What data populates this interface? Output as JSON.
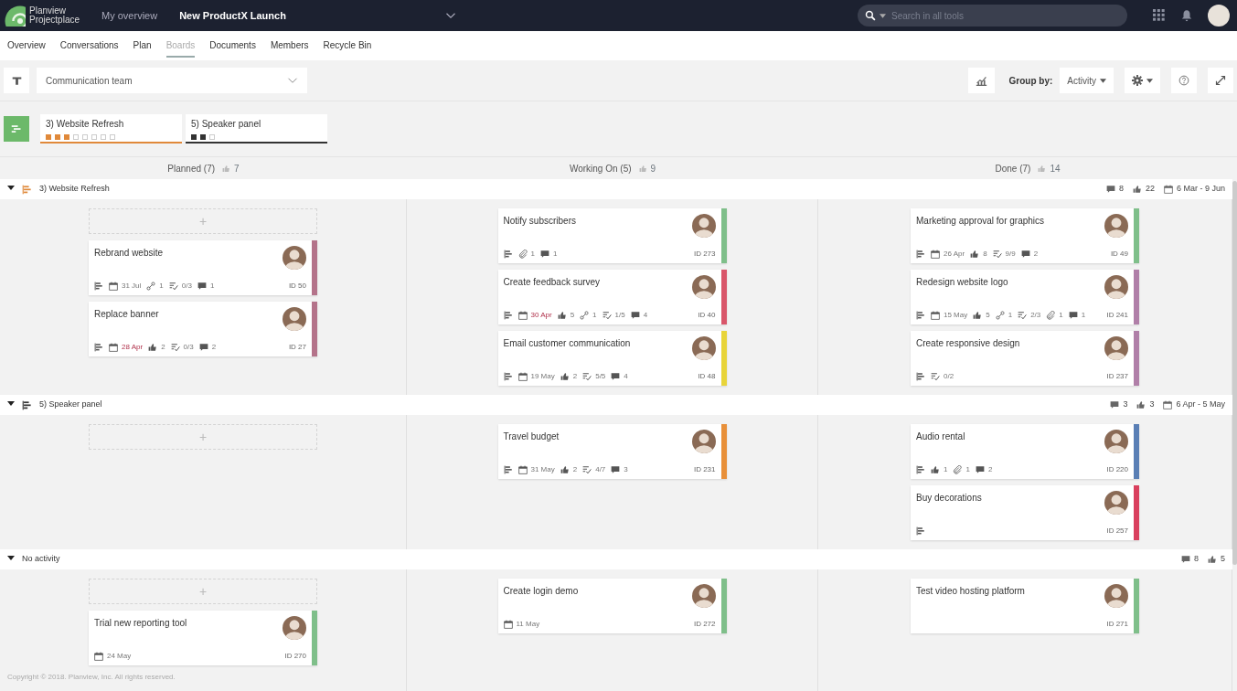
{
  "topbar": {
    "brand": [
      "Planview",
      "Projectplace"
    ],
    "links": [
      {
        "label": "My overview",
        "selected": false
      },
      {
        "label": "New ProductX Launch",
        "selected": true
      }
    ],
    "search": {
      "placeholder": "Search in all tools"
    }
  },
  "tabs": [
    {
      "label": "Overview",
      "selected": false
    },
    {
      "label": "Conversations",
      "selected": false
    },
    {
      "label": "Plan",
      "selected": false
    },
    {
      "label": "Boards",
      "selected": true
    },
    {
      "label": "Documents",
      "selected": false
    },
    {
      "label": "Members",
      "selected": false
    },
    {
      "label": "Recycle Bin",
      "selected": false
    }
  ],
  "toolbar": {
    "filter": {
      "value": "Communication team"
    },
    "group_by_label": "Group by:",
    "group_by": "Activity"
  },
  "plans": [
    {
      "label": "3) Website Refresh",
      "color": "#e0893a",
      "progress": [
        true,
        true,
        true,
        false,
        false,
        false,
        false,
        false
      ]
    },
    {
      "label": "5) Speaker panel",
      "color": "#333333",
      "progress": [
        true,
        true,
        false
      ]
    }
  ],
  "columns": [
    {
      "title": "Planned (7)",
      "likes": "7"
    },
    {
      "title": "Working On (5)",
      "likes": "9"
    },
    {
      "title": "Done (7)",
      "likes": "14"
    }
  ],
  "lanes": [
    {
      "name": "3) Website Refresh",
      "expanded": true,
      "color": "#e0893a",
      "summary": [
        {
          "kind": "comments",
          "text": "8"
        },
        {
          "kind": "likes",
          "text": "22"
        },
        {
          "kind": "date",
          "text": "6 Mar - 9 Jun"
        }
      ],
      "columns": [
        {
          "add_slot": "+",
          "cards": [
            {
              "title": "Rebrand website",
              "id": "ID 50",
              "color": "#b4738a",
              "meta": [
                {
                  "kind": "plan"
                },
                {
                  "kind": "date",
                  "text": "31 Jul"
                },
                {
                  "kind": "link",
                  "text": "1"
                },
                {
                  "kind": "checklist",
                  "text": "0/3"
                },
                {
                  "kind": "comments",
                  "text": "1"
                }
              ]
            },
            {
              "title": "Replace banner",
              "id": "ID 27",
              "color": "#b4738a",
              "meta": [
                {
                  "kind": "plan"
                },
                {
                  "kind": "overdue_date",
                  "text": "28 Apr"
                },
                {
                  "kind": "likes",
                  "text": "2"
                },
                {
                  "kind": "checklist",
                  "text": "0/3"
                },
                {
                  "kind": "comments",
                  "text": "2"
                }
              ]
            }
          ]
        },
        {
          "cards": [
            {
              "title": "Notify subscribers",
              "id": "ID 273",
              "color": "#7fbf8a",
              "meta": [
                {
                  "kind": "plan"
                },
                {
                  "kind": "attach",
                  "text": "1"
                },
                {
                  "kind": "comments",
                  "text": "1"
                }
              ]
            },
            {
              "title": "Create feedback survey",
              "id": "ID 40",
              "color": "#d9566a",
              "meta": [
                {
                  "kind": "plan"
                },
                {
                  "kind": "overdue_date",
                  "text": "30 Apr"
                },
                {
                  "kind": "likes",
                  "text": "5"
                },
                {
                  "kind": "link",
                  "text": "1"
                },
                {
                  "kind": "checklist",
                  "text": "1/5"
                },
                {
                  "kind": "comments",
                  "text": "4"
                }
              ]
            },
            {
              "title": "Email customer communication",
              "id": "ID 48",
              "color": "#e8d43a",
              "meta": [
                {
                  "kind": "plan"
                },
                {
                  "kind": "date",
                  "text": "19 May"
                },
                {
                  "kind": "likes",
                  "text": "2"
                },
                {
                  "kind": "checklist",
                  "text": "5/5"
                },
                {
                  "kind": "comments",
                  "text": "4"
                }
              ]
            }
          ]
        },
        {
          "cards": [
            {
              "title": "Marketing approval for graphics",
              "id": "ID 49",
              "color": "#7fbf8a",
              "meta": [
                {
                  "kind": "plan"
                },
                {
                  "kind": "date",
                  "text": "26 Apr"
                },
                {
                  "kind": "likes",
                  "text": "8"
                },
                {
                  "kind": "checklist",
                  "text": "9/9"
                },
                {
                  "kind": "comments",
                  "text": "2"
                }
              ]
            },
            {
              "title": "Redesign website logo",
              "id": "ID 241",
              "color": "#b07fa8",
              "meta": [
                {
                  "kind": "plan"
                },
                {
                  "kind": "date",
                  "text": "15 May"
                },
                {
                  "kind": "likes",
                  "text": "5"
                },
                {
                  "kind": "link",
                  "text": "1"
                },
                {
                  "kind": "checklist",
                  "text": "2/3"
                },
                {
                  "kind": "attach",
                  "text": "1"
                },
                {
                  "kind": "comments",
                  "text": "1"
                }
              ]
            },
            {
              "title": "Create responsive design",
              "id": "ID 237",
              "color": "#b07fa8",
              "meta": [
                {
                  "kind": "plan"
                },
                {
                  "kind": "checklist",
                  "text": "0/2"
                }
              ]
            }
          ]
        }
      ]
    },
    {
      "name": "5) Speaker panel",
      "expanded": true,
      "color": "#333333",
      "summary": [
        {
          "kind": "comments",
          "text": "3"
        },
        {
          "kind": "likes",
          "text": "3"
        },
        {
          "kind": "date",
          "text": "6 Apr - 5 May"
        }
      ],
      "columns": [
        {
          "add_slot": "+"
        },
        {
          "cards": [
            {
              "title": "Travel budget",
              "id": "ID 231",
              "color": "#e8903a",
              "meta": [
                {
                  "kind": "plan"
                },
                {
                  "kind": "date",
                  "text": "31 May"
                },
                {
                  "kind": "likes",
                  "text": "2"
                },
                {
                  "kind": "checklist",
                  "text": "4/7"
                },
                {
                  "kind": "comments",
                  "text": "3"
                }
              ]
            }
          ]
        },
        {
          "cards": [
            {
              "title": "Audio rental",
              "id": "ID 220",
              "color": "#5a7fb5",
              "meta": [
                {
                  "kind": "plan"
                },
                {
                  "kind": "likes",
                  "text": "1"
                },
                {
                  "kind": "attach",
                  "text": "1"
                },
                {
                  "kind": "comments",
                  "text": "2"
                }
              ]
            },
            {
              "title": "Buy decorations",
              "id": "ID 257",
              "color": "#d9405e",
              "meta": [
                {
                  "kind": "plan"
                }
              ]
            }
          ]
        }
      ]
    },
    {
      "name": "No activity",
      "expanded": true,
      "summary": [
        {
          "kind": "comments",
          "text": "8"
        },
        {
          "kind": "likes",
          "text": "5"
        }
      ],
      "columns": [
        {
          "add_slot": "+",
          "cards": [
            {
              "title": "Trial new reporting tool",
              "id": "ID 270",
              "color": "#7fbf8a",
              "meta": [
                {
                  "kind": "date",
                  "text": "24 May"
                }
              ]
            }
          ]
        },
        {
          "cards": [
            {
              "title": "Create login demo",
              "id": "ID 272",
              "color": "#7fbf8a",
              "meta": [
                {
                  "kind": "date",
                  "text": "11 May"
                }
              ]
            }
          ]
        },
        {
          "cards": [
            {
              "title": "Test video hosting platform",
              "id": "ID 271",
              "color": "#7fbf8a"
            }
          ]
        }
      ]
    }
  ],
  "footer": "Copyright © 2018. Planview, Inc. All rights reserved."
}
